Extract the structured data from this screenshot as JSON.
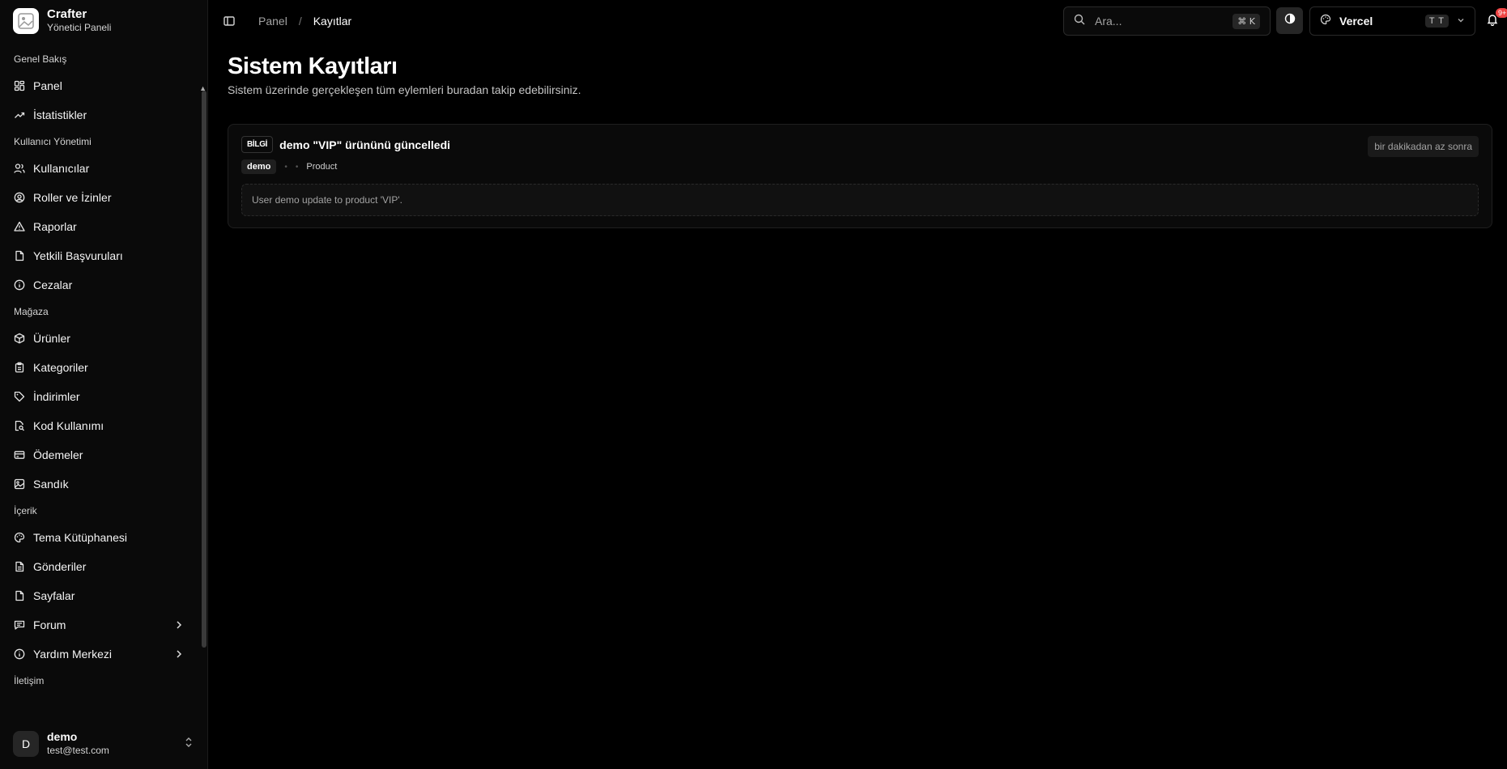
{
  "brand": {
    "title": "Crafter",
    "subtitle": "Yönetici Paneli"
  },
  "sidebar": {
    "groups": [
      {
        "label": "Genel Bakış",
        "items": [
          {
            "label": "Panel",
            "icon": "dashboard-icon"
          },
          {
            "label": "İstatistikler",
            "icon": "trending-up-icon"
          }
        ]
      },
      {
        "label": "Kullanıcı Yönetimi",
        "items": [
          {
            "label": "Kullanıcılar",
            "icon": "users-icon"
          },
          {
            "label": "Roller ve İzinler",
            "icon": "user-circle-icon"
          },
          {
            "label": "Raporlar",
            "icon": "warning-triangle-icon"
          },
          {
            "label": "Yetkili Başvuruları",
            "icon": "file-icon"
          },
          {
            "label": "Cezalar",
            "icon": "info-circle-icon"
          }
        ]
      },
      {
        "label": "Mağaza",
        "items": [
          {
            "label": "Ürünler",
            "icon": "box-icon"
          },
          {
            "label": "Kategoriler",
            "icon": "clipboard-icon"
          },
          {
            "label": "İndirimler",
            "icon": "tag-icon"
          },
          {
            "label": "Kod Kullanımı",
            "icon": "file-search-icon"
          },
          {
            "label": "Ödemeler",
            "icon": "credit-card-icon"
          },
          {
            "label": "Sandık",
            "icon": "image-icon"
          }
        ]
      },
      {
        "label": "İçerik",
        "items": [
          {
            "label": "Tema Kütüphanesi",
            "icon": "palette-icon"
          },
          {
            "label": "Gönderiler",
            "icon": "document-icon"
          },
          {
            "label": "Sayfalar",
            "icon": "file-icon"
          },
          {
            "label": "Forum",
            "icon": "message-square-icon",
            "chevron": true
          },
          {
            "label": "Yardım Merkezi",
            "icon": "info-circle-icon",
            "chevron": true
          }
        ]
      },
      {
        "label": "İletişim",
        "items": []
      }
    ]
  },
  "user": {
    "initial": "D",
    "name": "demo",
    "email": "test@test.com"
  },
  "topbar": {
    "breadcrumb_prev": "Panel",
    "breadcrumb_sep": "/",
    "breadcrumb_current": "Kayıtlar",
    "search_placeholder": "Ara...",
    "search_shortcut": "⌘ K",
    "team_name": "Vercel",
    "team_badge": "T T",
    "notification_count": "9+"
  },
  "page": {
    "title": "Sistem Kayıtları",
    "subtitle": "Sistem üzerinde gerçekleşen tüm eylemleri buradan takip edebilirsiniz."
  },
  "logs": [
    {
      "level": "BİLGİ",
      "title": "demo \"VIP\" ürününü güncelledi",
      "time": "bir dakikadan az sonra",
      "user": "demo",
      "entity": "Product",
      "message": "User demo update to product 'VIP'."
    }
  ],
  "colors": {
    "background": "#000000",
    "sidebar": "#0a0a0a",
    "badge": "#ef4444"
  }
}
